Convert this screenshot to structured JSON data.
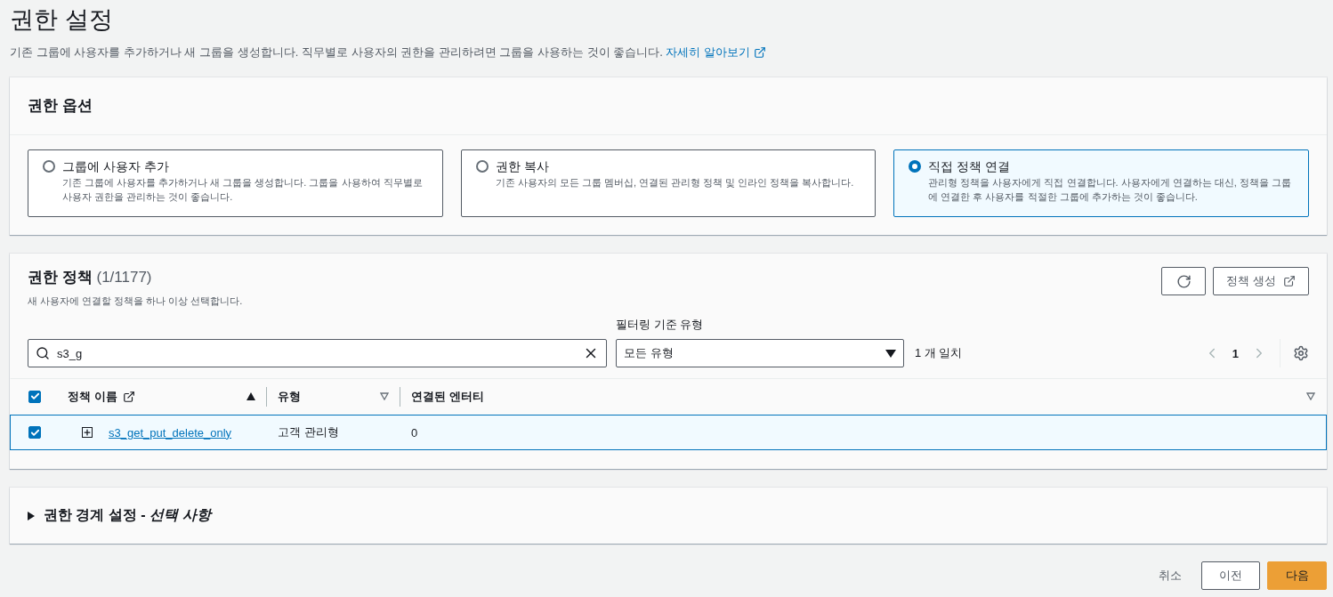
{
  "page": {
    "title": "권한 설정",
    "description": "기존 그룹에 사용자를 추가하거나 새 그룹을 생성합니다. 직무별로 사용자의 권한을 관리하려면 그룹을 사용하는 것이 좋습니다.",
    "learn_more": "자세히 알아보기"
  },
  "permission_options": {
    "title": "권한 옵션",
    "options": [
      {
        "label": "그룹에 사용자 추가",
        "description": "기존 그룹에 사용자를 추가하거나 새 그룹을 생성합니다. 그룹을 사용하여 직무별로 사용자 권한을 관리하는 것이 좋습니다.",
        "selected": false
      },
      {
        "label": "권한 복사",
        "description": "기존 사용자의 모든 그룹 멤버십, 연결된 관리형 정책 및 인라인 정책을 복사합니다.",
        "selected": false
      },
      {
        "label": "직접 정책 연결",
        "description": "관리형 정책을 사용자에게 직접 연결합니다. 사용자에게 연결하는 대신, 정책을 그룹에 연결한 후 사용자를 적절한 그룹에 추가하는 것이 좋습니다.",
        "selected": true
      }
    ]
  },
  "policies": {
    "title": "권한 정책",
    "count": "(1/1177)",
    "description": "새 사용자에 연결할 정책을 하나 이상 선택합니다.",
    "create_button": "정책 생성",
    "search": {
      "value": "s3_g"
    },
    "filter": {
      "label": "필터링 기준 유형",
      "value": "모든 유형"
    },
    "match_count": "1 개 일치",
    "page": "1",
    "all_checked": true,
    "columns": [
      {
        "label": "정책 이름",
        "link": true,
        "sorted": true
      },
      {
        "label": "유형",
        "link": false,
        "sorted": false
      },
      {
        "label": "연결된 엔터티",
        "link": false,
        "sorted": false
      }
    ],
    "rows": [
      {
        "name": "s3_get_put_delete_only",
        "type": "고객 관리형",
        "entities": "0",
        "selected": true
      }
    ]
  },
  "boundary": {
    "title": "권한 경계 설정 - ",
    "title_italic": "선택 사항",
    "expanded": false
  },
  "footer": {
    "cancel": "취소",
    "previous": "이전",
    "next": "다음"
  }
}
